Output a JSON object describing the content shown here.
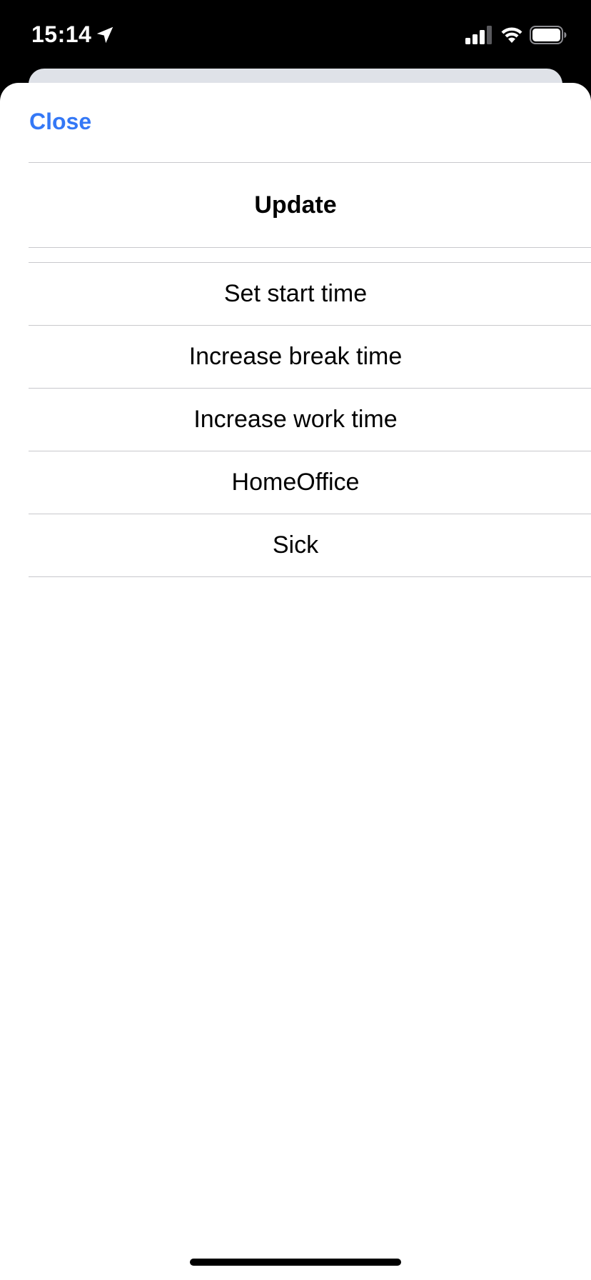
{
  "status_bar": {
    "time": "15:14",
    "icons": [
      "location-arrow-icon",
      "cellular-signal-icon",
      "wifi-icon",
      "battery-icon"
    ]
  },
  "sheet": {
    "close_label": "Close",
    "title": "Update",
    "options": [
      {
        "label": "Set start time"
      },
      {
        "label": "Increase break time"
      },
      {
        "label": "Increase work time"
      },
      {
        "label": "HomeOffice"
      },
      {
        "label": "Sick"
      }
    ]
  },
  "colors": {
    "accent": "#3478f6",
    "separator": "#c8c8cc",
    "background": "#ffffff",
    "status_bar_background": "#000000"
  }
}
